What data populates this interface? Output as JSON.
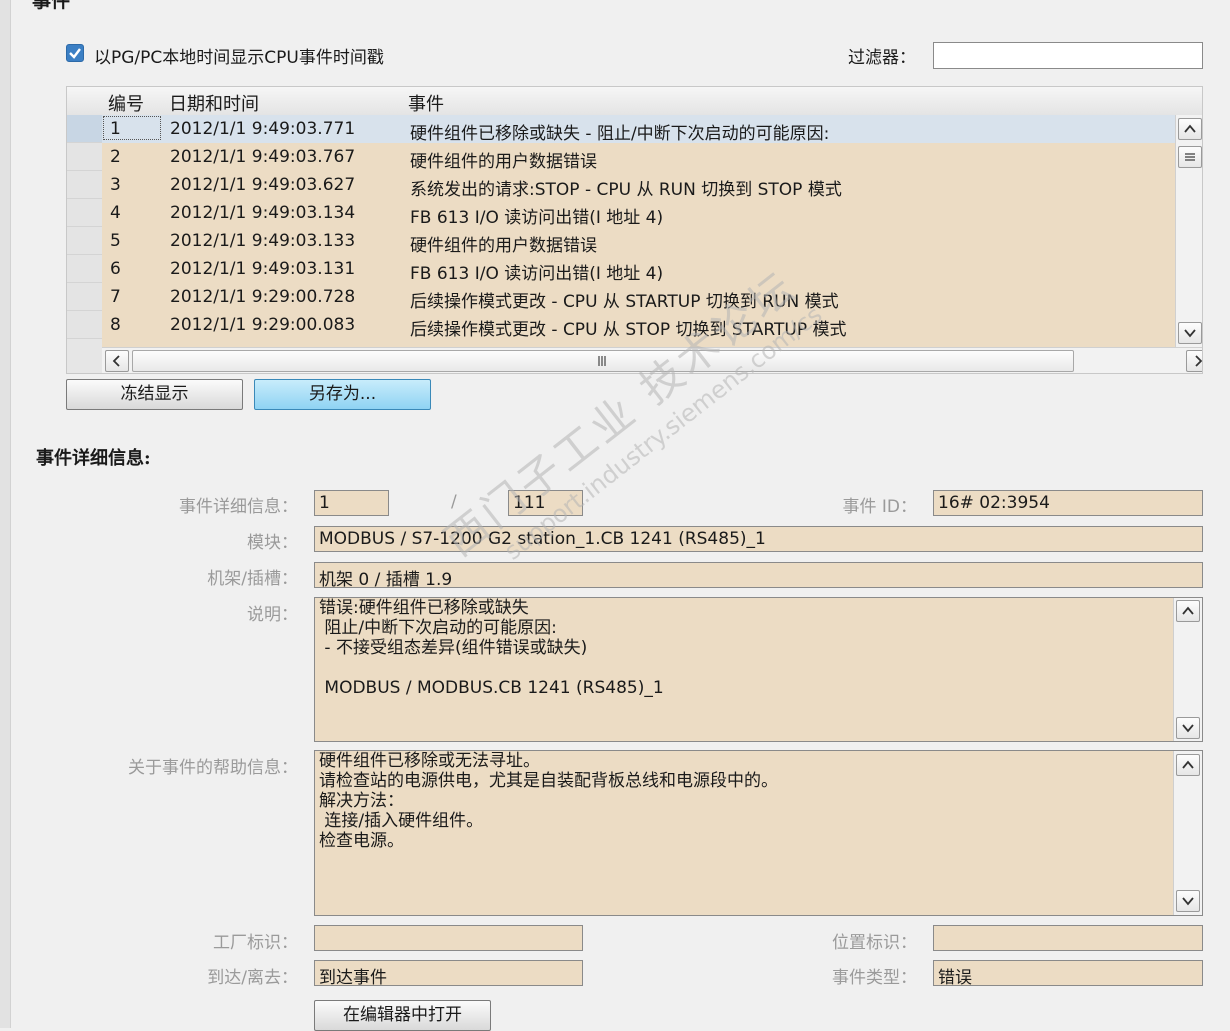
{
  "section_title": "事件",
  "options": {
    "checkbox_label": "以PG/PC本地时间显示CPU事件时间戳",
    "checkbox_checked": true,
    "filter_label": "过滤器：",
    "filter_value": ""
  },
  "table": {
    "headers": [
      "编号",
      "日期和时间",
      "事件"
    ],
    "rows": [
      {
        "num": "1",
        "datetime": "2012/1/1 9:49:03.771",
        "event": "硬件组件已移除或缺失  - 阻止/中断下次启动的可能原因:"
      },
      {
        "num": "2",
        "datetime": "2012/1/1 9:49:03.767",
        "event": "硬件组件的用户数据错误"
      },
      {
        "num": "3",
        "datetime": "2012/1/1 9:49:03.627",
        "event": "系统发出的请求:STOP  - CPU 从 RUN 切换到 STOP 模式"
      },
      {
        "num": "4",
        "datetime": "2012/1/1 9:49:03.134",
        "event": "FB 613  I/O 读访问出错(I 地址 4)"
      },
      {
        "num": "5",
        "datetime": "2012/1/1 9:49:03.133",
        "event": "硬件组件的用户数据错误"
      },
      {
        "num": "6",
        "datetime": "2012/1/1 9:49:03.131",
        "event": "FB 613  I/O 读访问出错(I 地址 4)"
      },
      {
        "num": "7",
        "datetime": "2012/1/1 9:29:00.728",
        "event": "后续操作模式更改  - CPU 从 STARTUP 切换到 RUN 模式"
      },
      {
        "num": "8",
        "datetime": "2012/1/1 9:29:00.083",
        "event": "后续操作模式更改  - CPU 从 STOP 切换到 STARTUP 模式"
      }
    ],
    "selected_row": 1
  },
  "buttons": {
    "freeze": "冻结显示",
    "save_as": "另存为..."
  },
  "details": {
    "title": "事件详细信息:",
    "detail_label": "事件详细信息：",
    "current_index": "1",
    "separator": "/",
    "total": "111",
    "event_id_label": "事件 ID：",
    "event_id": "16# 02:3954",
    "module_label": "模块：",
    "module": "MODBUS / S7-1200 G2 station_1.CB 1241 (RS485)_1",
    "rack_label": "机架/插槽：",
    "rack": "机架 0 / 插槽 1.9",
    "description_label": "说明：",
    "description": "错误:硬件组件已移除或缺失\n 阻止/中断下次启动的可能原因:\n - 不接受组态差异(组件错误或缺失)\n\n MODBUS / MODBUS.CB 1241 (RS485)_1",
    "help_label": "关于事件的帮助信息：",
    "help": "硬件组件已移除或无法寻址。\n请检查站的电源供电，尤其是自装配背板总线和电源段中的。\n解决方法：\n 连接/插入硬件组件。\n检查电源。",
    "plant_label": "工厂标识：",
    "plant": "",
    "location_label": "位置标识：",
    "location": "",
    "arrival_label": "到达/离去：",
    "arrival": "到达事件",
    "event_type_label": "事件类型：",
    "event_type": "错误",
    "open_editor": "在编辑器中打开"
  },
  "watermark": {
    "line1": "西门子工业  技术论坛",
    "line2": "support.industry.siemens.com/cs"
  },
  "colors": {
    "field_bg": "#ecdcc4",
    "selected_row": "#d8e2ec",
    "blue_button": "#8fd3f3",
    "checkbox": "#3b7fc4"
  }
}
